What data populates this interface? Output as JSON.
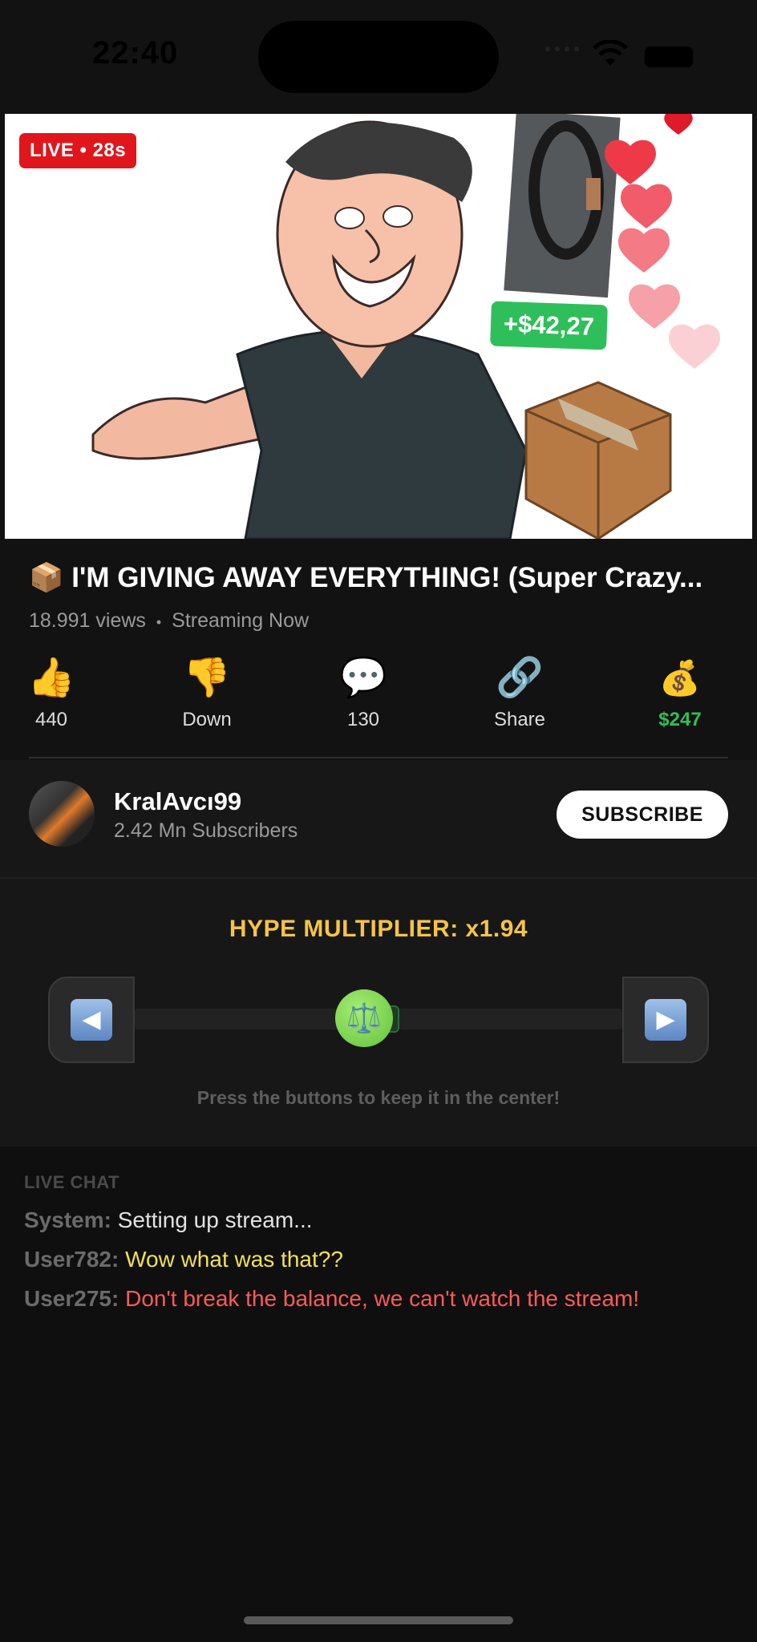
{
  "status_bar": {
    "time": "22:40"
  },
  "video": {
    "live_badge": "LIVE • 28s",
    "tip_popup": "+$42,27"
  },
  "stream": {
    "title": "📦 I'M GIVING AWAY EVERYTHING! (Super Crazy...",
    "views": "18.991 views",
    "separator": "•",
    "status": "Streaming Now"
  },
  "actions": [
    {
      "icon": "👍",
      "label": "440"
    },
    {
      "icon": "👎",
      "label": "Down"
    },
    {
      "icon": "💬",
      "label": "130"
    },
    {
      "icon": "🔗",
      "label": "Share"
    },
    {
      "icon": "💰",
      "label": "$247"
    }
  ],
  "channel": {
    "name": "KralAvcı99",
    "subscribers": "2.42 Mn Subscribers",
    "subscribe_label": "SUBSCRIBE"
  },
  "game": {
    "title": "HYPE MULTIPLIER: x1.94",
    "knob_icon": "⚖️",
    "left_arrow": "◀",
    "right_arrow": "▶",
    "hint": "Press the buttons to keep it in the center!",
    "balance_position": 0.47
  },
  "chat": {
    "header": "LIVE CHAT",
    "messages": [
      {
        "user": "System:",
        "text": "Setting up stream..."
      },
      {
        "user": "User782:",
        "text": "Wow what was that??"
      },
      {
        "user": "User275:",
        "text": "Don't break the balance, we can't watch the stream!"
      }
    ]
  },
  "colors": {
    "live_red": "#e0161c",
    "tip_green": "#2fbf5a",
    "hype_yellow": "#f6c445",
    "money_green": "#2fbf5a"
  }
}
